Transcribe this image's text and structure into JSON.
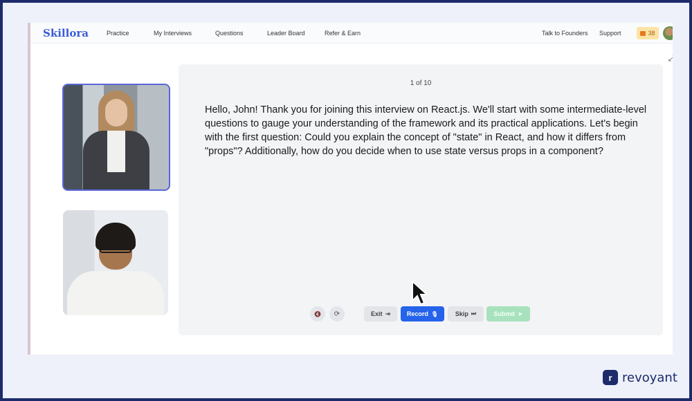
{
  "nav": {
    "logo": "Skillora",
    "links": [
      "Practice",
      "My Interviews",
      "Questions",
      "Leader Board",
      "Refer & Earn"
    ],
    "right_links": [
      "Talk to Founders",
      "Support"
    ],
    "coins": "38"
  },
  "interview": {
    "progress": "1 of 10",
    "question": "Hello, John! Thank you for joining this interview on React.js. We'll start with some intermediate-level questions to gauge your understanding of the framework and its practical applications. Let's begin with the first question: Could you explain the concept of \"state\" in React, and how it differs from \"props\"? Additionally, how do you decide when to use state versus props in a component?"
  },
  "controls": {
    "mute_icon": "🔇",
    "refresh_icon": "⟳",
    "exit": "Exit",
    "exit_icon": "⇥",
    "record": "Record",
    "record_icon": "🎙",
    "skip": "Skip",
    "skip_icon": "⏭",
    "submit": "Submit",
    "submit_icon": "➤"
  },
  "brand": {
    "mark": "r",
    "name": "revoyant"
  },
  "icons": {
    "expand": "⤢"
  },
  "colors": {
    "accent": "#2563eb",
    "frame": "#1d2b6b",
    "submit_disabled": "#a8e2bd",
    "coin_badge": "#fde4a6"
  }
}
